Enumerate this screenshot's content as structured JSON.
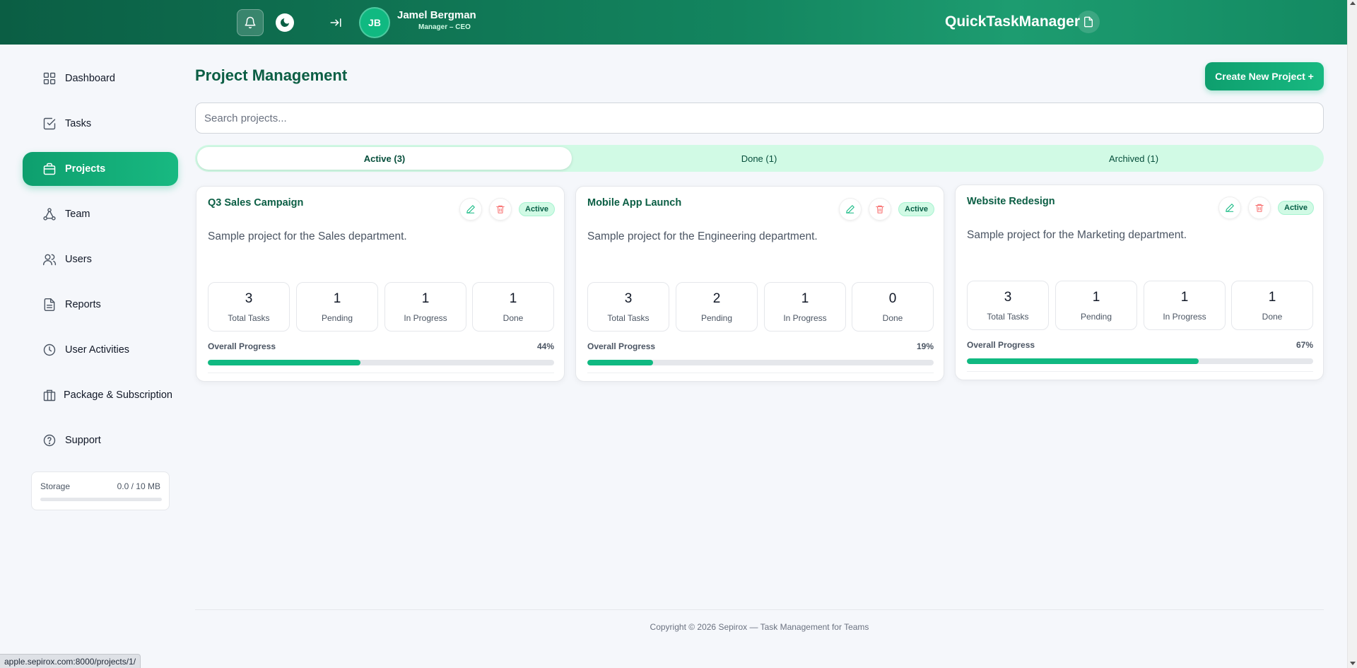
{
  "header": {
    "user_initials": "JB",
    "user_name": "Jamel Bergman",
    "user_role": "Manager – CEO",
    "brand": "QuickTaskManager"
  },
  "sidebar": {
    "items": [
      {
        "label": "Dashboard",
        "icon": "grid-icon"
      },
      {
        "label": "Tasks",
        "icon": "checkbox-icon"
      },
      {
        "label": "Projects",
        "icon": "briefcase-icon",
        "active": true
      },
      {
        "label": "Team",
        "icon": "team-network-icon"
      },
      {
        "label": "Users",
        "icon": "users-icon"
      },
      {
        "label": "Reports",
        "icon": "document-icon"
      },
      {
        "label": "User Activities",
        "icon": "clock-icon"
      },
      {
        "label": "Package & Subscription",
        "icon": "package-icon"
      },
      {
        "label": "Support",
        "icon": "help-circle-icon"
      }
    ],
    "storage": {
      "label": "Storage",
      "value": "0.0 / 10 MB",
      "fraction": 0.0
    }
  },
  "main": {
    "title": "Project Management",
    "create_label": "Create New Project +",
    "search_placeholder": "Search projects...",
    "tabs": [
      {
        "label": "Active (3)",
        "active": true
      },
      {
        "label": "Done (1)"
      },
      {
        "label": "Archived (1)"
      }
    ],
    "progress_label": "Overall Progress",
    "stat_labels": {
      "total": "Total Tasks",
      "pending": "Pending",
      "in_progress": "In Progress",
      "done": "Done"
    },
    "projects": [
      {
        "title": "Q3 Sales Campaign",
        "status": "Active",
        "description": "Sample project for the Sales department.",
        "total": "3",
        "pending": "1",
        "in_progress": "1",
        "done": "1",
        "progress": 44,
        "progress_text": "44%"
      },
      {
        "title": "Mobile App Launch",
        "status": "Active",
        "description": "Sample project for the Engineering department.",
        "total": "3",
        "pending": "2",
        "in_progress": "1",
        "done": "0",
        "progress": 19,
        "progress_text": "19%"
      },
      {
        "title": "Website Redesign",
        "status": "Active",
        "description": "Sample project for the Marketing department.",
        "total": "3",
        "pending": "1",
        "in_progress": "1",
        "done": "1",
        "progress": 67,
        "progress_text": "67%"
      }
    ]
  },
  "footer": {
    "copyright": "Copyright © 2026 Sepirox — Task Management for Teams"
  },
  "status_bar": {
    "url": "apple.sepirox.com:8000/projects/1/"
  },
  "colors": {
    "primary": "#10b981",
    "primary_dark": "#0b5e44",
    "delete": "#f87171"
  }
}
